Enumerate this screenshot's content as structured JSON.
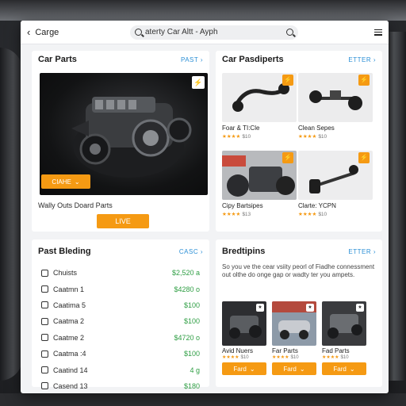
{
  "header": {
    "back_label": "Carge",
    "search_value": "aterty Car Altt - Ayph"
  },
  "card_featured": {
    "title": "Car Parts",
    "more": "PAST",
    "hero_button": "CIAHE",
    "description": "Wally Outs Doard Parts",
    "live_button": "LIVE"
  },
  "card_parts": {
    "title": "Car Pasdiperts",
    "more": "ETTER",
    "items": [
      {
        "name": "Foar & TI:Cle",
        "stars": "★★★★",
        "rating": "$10"
      },
      {
        "name": "Clean Sepes",
        "stars": "★★★★",
        "rating": "$10"
      },
      {
        "name": "Cipy Bartsipes",
        "stars": "★★★★",
        "rating": "$13"
      },
      {
        "name": "Clarte: YCPN",
        "stars": "★★★★",
        "rating": "$10"
      }
    ]
  },
  "card_listing": {
    "title": "Past Bleding",
    "more": "CASC",
    "rows": [
      {
        "label": "Chuists",
        "value": "$2,520 a"
      },
      {
        "label": "Caatmn 1",
        "value": "$4280 o"
      },
      {
        "label": "Caatima 5",
        "value": "$100"
      },
      {
        "label": "Caatma 2",
        "value": "$100"
      },
      {
        "label": "Caatme 2",
        "value": "$4720 o"
      },
      {
        "label": "Caatma :4",
        "value": "$100"
      },
      {
        "label": "Caatind 14",
        "value": "4 g"
      },
      {
        "label": "Casend 13",
        "value": "$180"
      }
    ]
  },
  "card_breakdown": {
    "title": "Bredtipins",
    "more": "ETTER",
    "body": "So you ve the cear vsiity peorl of Fiadhe connessment out olthe do onge gap or wadty ter you ampets.",
    "tiles": [
      {
        "name": "Avid Nuers",
        "stars": "★★★★",
        "rating": "$10",
        "button": "Fard"
      },
      {
        "name": "Far Parts",
        "stars": "★★★★",
        "rating": "$10",
        "button": "Fard"
      },
      {
        "name": "Fad Parts",
        "stars": "★★★★",
        "rating": "$10",
        "button": "Fard"
      }
    ]
  },
  "colors": {
    "accent": "#f59a13",
    "link": "#2b8fd6",
    "price": "#2f9e44"
  }
}
